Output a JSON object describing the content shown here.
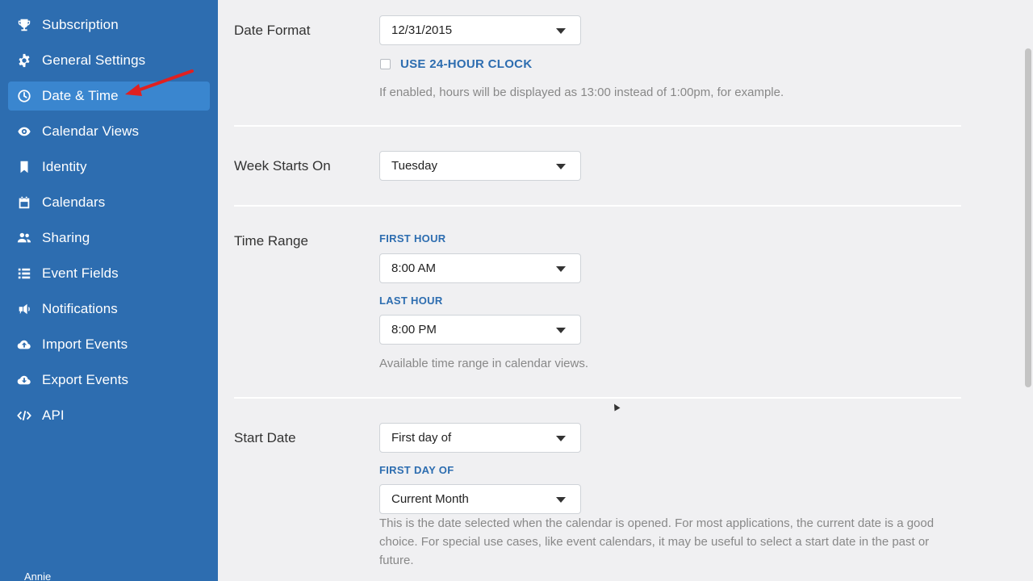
{
  "sidebar": {
    "items": [
      {
        "label": "Subscription",
        "icon": "trophy-icon"
      },
      {
        "label": "General Settings",
        "icon": "gear-icon"
      },
      {
        "label": "Date & Time",
        "icon": "clock-icon",
        "active": true
      },
      {
        "label": "Calendar Views",
        "icon": "eye-icon"
      },
      {
        "label": "Identity",
        "icon": "bookmark-icon"
      },
      {
        "label": "Calendars",
        "icon": "calendar-icon"
      },
      {
        "label": "Sharing",
        "icon": "users-icon"
      },
      {
        "label": "Event Fields",
        "icon": "list-icon"
      },
      {
        "label": "Notifications",
        "icon": "bullhorn-icon"
      },
      {
        "label": "Import Events",
        "icon": "cloud-upload-icon"
      },
      {
        "label": "Export Events",
        "icon": "cloud-download-icon"
      },
      {
        "label": "API",
        "icon": "code-icon"
      }
    ],
    "user": "Annie",
    "colors": {
      "background": "#2d6db0",
      "active": "#3a86cf",
      "arrow": "#e02020"
    }
  },
  "main": {
    "date_format": {
      "label": "Date Format",
      "value": "12/31/2015",
      "checkbox_label": "USE 24-HOUR CLOCK",
      "checkbox_checked": false,
      "help": "If enabled, hours will be displayed as 13:00 instead of 1:00pm, for example."
    },
    "week_start": {
      "label": "Week Starts On",
      "value": "Tuesday"
    },
    "time_range": {
      "label": "Time Range",
      "first_hour_label": "FIRST HOUR",
      "first_hour_value": "8:00 AM",
      "last_hour_label": "LAST HOUR",
      "last_hour_value": "8:00 PM",
      "help": "Available time range in calendar views."
    },
    "start_date": {
      "label": "Start Date",
      "value": "First day of",
      "first_day_label": "FIRST DAY OF",
      "first_day_value": "Current Month",
      "help": "This is the date selected when the calendar is opened. For most applications, the current date is a good choice. For special use cases, like event calendars, it may be useful to select a start date in the past or future."
    },
    "accent_color": "#2d6db0"
  }
}
